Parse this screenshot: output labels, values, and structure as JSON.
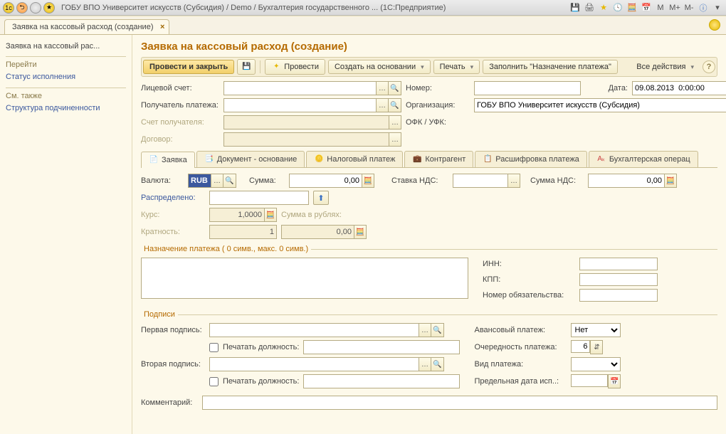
{
  "title": "ГОБУ ВПО Университет искусств (Субсидия) / Demo / Бухгалтерия государственного ... (1С:Предприятие)",
  "doc_tab": "Заявка на кассовый расход (создание)",
  "sidebar": {
    "title": "Заявка на кассовый рас...",
    "goto": "Перейти",
    "status": "Статус исполнения",
    "seealso": "См. также",
    "structure": "Структура подчиненности"
  },
  "page_title": "Заявка на кассовый расход (создание)",
  "toolbar": {
    "post_close": "Провести и закрыть",
    "post": "Провести",
    "create_based": "Создать на основании",
    "print": "Печать",
    "fill": "Заполнить \"Назначение платежа\"",
    "all_actions": "Все действия"
  },
  "fields": {
    "account": "Лицевой счет:",
    "number": "Номер:",
    "date_lbl": "Дата:",
    "date_val": "09.08.2013  0:00:00",
    "payee": "Получатель платежа:",
    "org_lbl": "Организация:",
    "org_val": "ГОБУ ВПО Университет искусств (Субсидия)",
    "payee_acc": "Счет получателя:",
    "ofk": "ОФК / УФК:",
    "contract": "Договор:"
  },
  "subtabs": {
    "t1": "Заявка",
    "t2": "Документ - основание",
    "t3": "Налоговый платеж",
    "t4": "Контрагент",
    "t5": "Расшифровка платежа",
    "t6": "Бухгалтерская операц"
  },
  "req": {
    "currency_lbl": "Валюта:",
    "currency_val": "RUB",
    "sum_lbl": "Сумма:",
    "sum_val": "0,00",
    "vat_rate_lbl": "Ставка НДС:",
    "vat_sum_lbl": "Сумма НДС:",
    "vat_sum_val": "0,00",
    "distributed": "Распределено:",
    "rate_lbl": "Курс:",
    "rate_val": "1,0000",
    "sum_rub_lbl": "Сумма в рублях:",
    "mult_lbl": "Кратность:",
    "mult_val": "1",
    "mult_sum": "0,00"
  },
  "purpose": {
    "legend": "Назначение платежа ( 0 симв., макс. 0 симв.)",
    "inn": "ИНН:",
    "kpp": "КПП:",
    "obl_num": "Номер обязательства:"
  },
  "sig": {
    "legend": "Подписи",
    "first": "Первая подпись:",
    "second": "Вторая подпись:",
    "print_pos": "Печатать должность:",
    "advance": "Авансовый платеж:",
    "advance_val": "Нет",
    "priority": "Очередность платежа:",
    "priority_val": "6",
    "pay_type": "Вид платежа:",
    "deadline": "Предельная дата исп..:"
  },
  "comment_lbl": "Комментарий:",
  "tb_icons": {
    "m": "M",
    "mp": "M+",
    "mm": "M-"
  }
}
